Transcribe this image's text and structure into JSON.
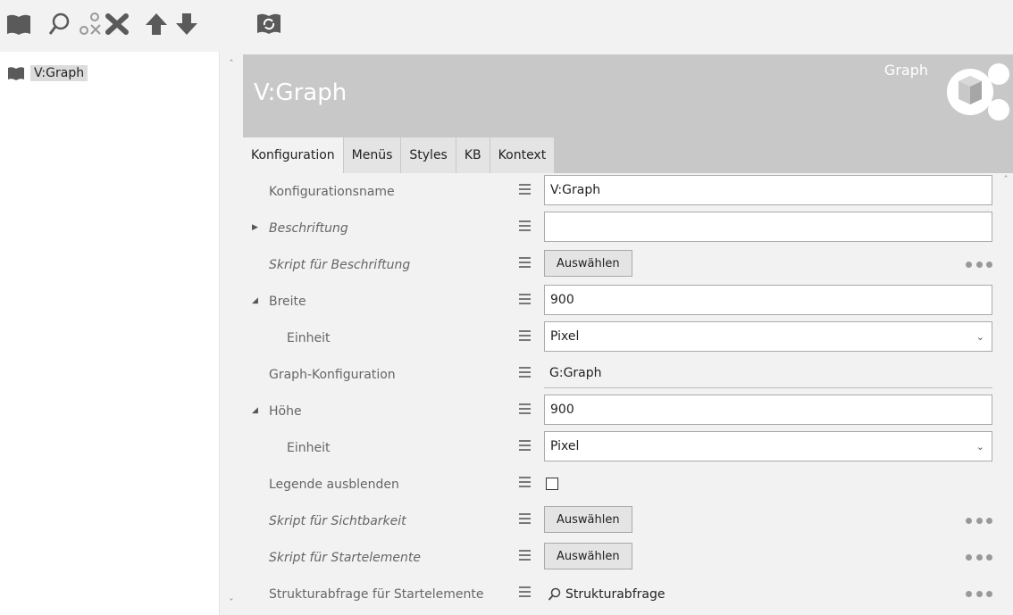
{
  "toolbar": {
    "icons": [
      "book-icon",
      "search-icon",
      "disconnect-icon",
      "delete-icon",
      "move-up-icon",
      "move-down-icon",
      "refresh-book-icon"
    ]
  },
  "tree": {
    "items": [
      {
        "label": "V:Graph",
        "icon": "book-icon"
      }
    ]
  },
  "header": {
    "title": "V:Graph",
    "type_label": "Graph"
  },
  "tabs": [
    {
      "label": "Konfiguration",
      "active": true
    },
    {
      "label": "Menüs",
      "active": false
    },
    {
      "label": "Styles",
      "active": false
    },
    {
      "label": "KB",
      "active": false
    },
    {
      "label": "Kontext",
      "active": false
    }
  ],
  "form": {
    "rows": [
      {
        "label": "Konfigurationsname",
        "kind": "text",
        "value": "V:Graph"
      },
      {
        "label": "Beschriftung",
        "kind": "text",
        "value": "",
        "expander": "collapsed",
        "italic": true
      },
      {
        "label": "Skript für Beschriftung",
        "kind": "button",
        "value": "Auswählen",
        "italic": true
      },
      {
        "label": "Breite",
        "kind": "text",
        "value": "900",
        "expander": "expanded"
      },
      {
        "label": "Einheit",
        "kind": "select",
        "value": "Pixel",
        "indent": true
      },
      {
        "label": "Graph-Konfiguration",
        "kind": "static",
        "value": "G:Graph"
      },
      {
        "label": "Höhe",
        "kind": "text",
        "value": "900",
        "expander": "expanded"
      },
      {
        "label": "Einheit",
        "kind": "select",
        "value": "Pixel",
        "indent": true
      },
      {
        "label": "Legende ausblenden",
        "kind": "checkbox",
        "checked": false
      },
      {
        "label": "Skript für Sichtbarkeit",
        "kind": "button",
        "value": "Auswählen",
        "italic": true
      },
      {
        "label": "Skript für Startelemente",
        "kind": "button",
        "value": "Auswählen",
        "italic": true
      },
      {
        "label": "Strukturabfrage für Startelemente",
        "kind": "link",
        "value": "Strukturabfrage"
      }
    ]
  },
  "colors": {
    "header_bg": "#c8c8c8",
    "icon_dark": "#5a5a5a",
    "icon_light": "#8a8a8a"
  }
}
